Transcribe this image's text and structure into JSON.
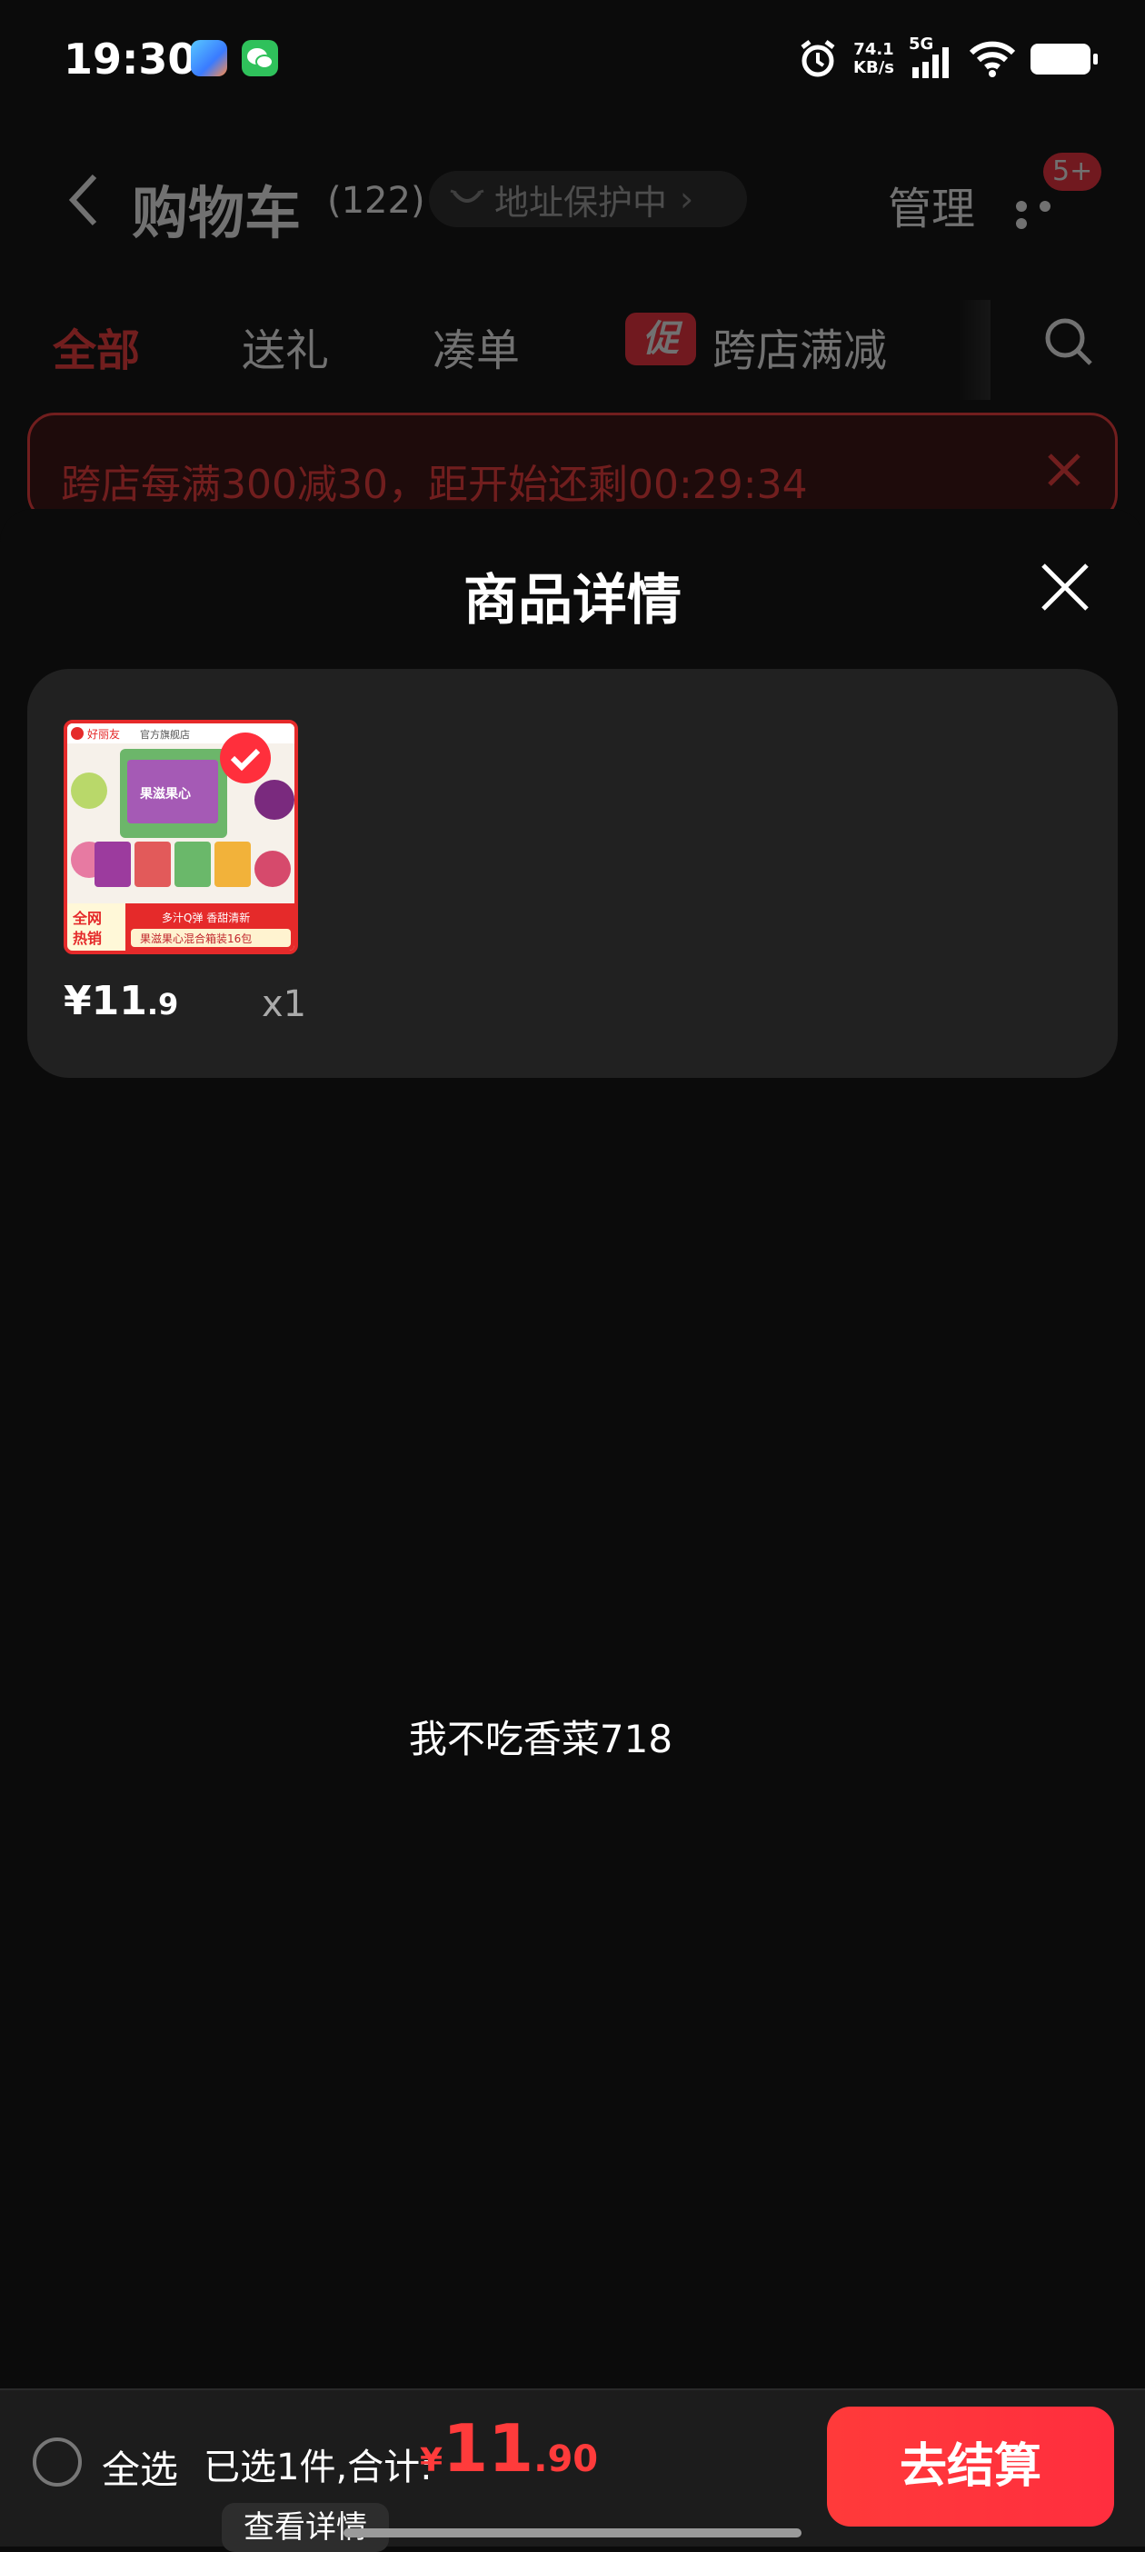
{
  "status_bar": {
    "time": "19:30",
    "net_speed": "74.1",
    "net_unit": "KB/s",
    "net_type": "5G"
  },
  "header": {
    "title": "购物车",
    "count": "(122)",
    "address_pill": "地址保护中",
    "manage": "管理",
    "badge": "5+"
  },
  "tabs": [
    {
      "label": "全部",
      "active": true
    },
    {
      "label": "送礼"
    },
    {
      "label": "凑单"
    },
    {
      "label": "跨店满减",
      "tag": "促"
    }
  ],
  "banner": {
    "text": "跨店每满300减30，距开始还剩00:29:34"
  },
  "sheet": {
    "title": "商品详情",
    "item": {
      "price_int": "¥11",
      "price_dec": ".9",
      "qty": "x1",
      "image": {
        "brand": "好丽友",
        "store": "官方旗舰店",
        "product_brand": "果滋果心",
        "hot_line1": "全网",
        "hot_line2": "热销",
        "slogan": "多汁Q弹 香甜清新",
        "desc": "果滋果心混合箱装16包"
      }
    },
    "shop_name": "我不吃香菜718"
  },
  "bottom_bar": {
    "select_all": "全选",
    "summary": "已选1件,合计:",
    "currency": "¥",
    "total_int": "11",
    "total_dec": ".90",
    "detail": "查看详情",
    "checkout": "去结算"
  },
  "colors": {
    "accent": "#ff3b3b",
    "background": "#0b0b0b",
    "card": "#212121"
  }
}
